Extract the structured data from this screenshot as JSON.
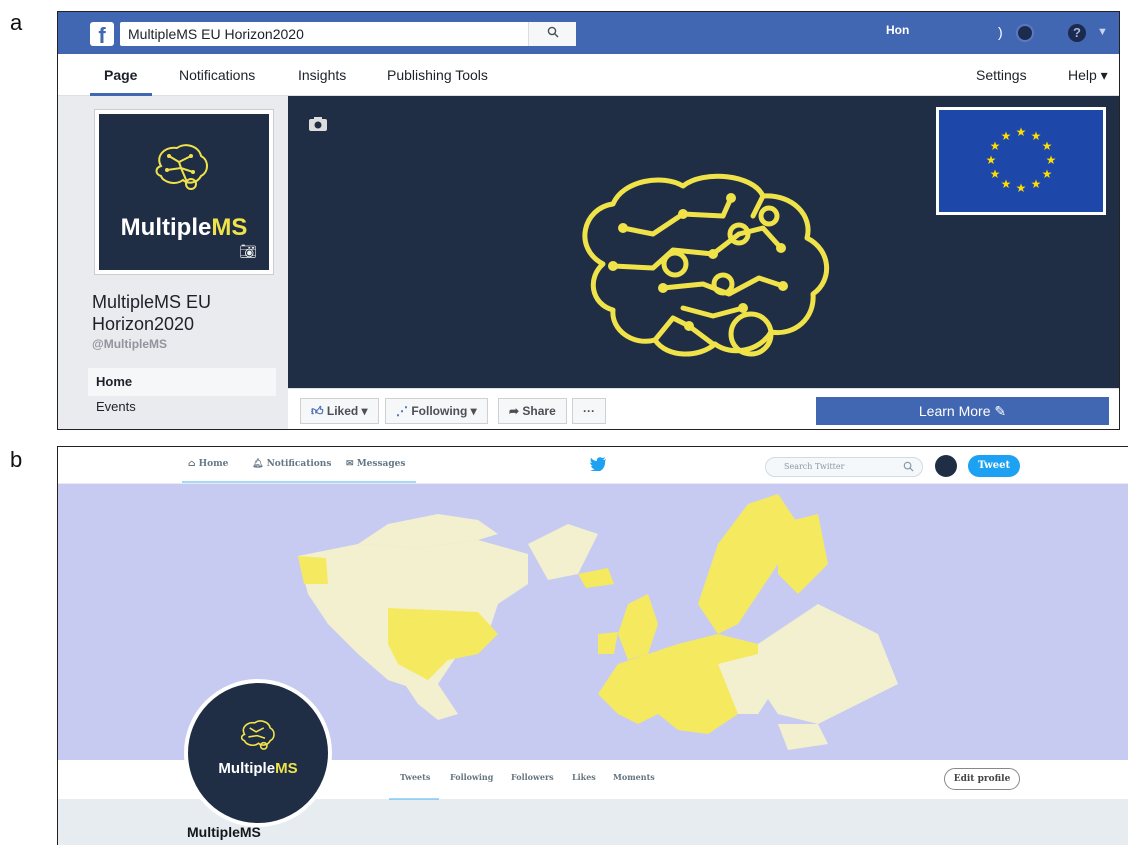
{
  "panel_letters": {
    "a": "a",
    "b": "b"
  },
  "facebook": {
    "search_value": "MultipleMS EU Horizon2020",
    "top_home": "Hon",
    "top_paren": ")",
    "tabs": [
      {
        "label": "Page"
      },
      {
        "label": "Notifications"
      },
      {
        "label": "Insights"
      },
      {
        "label": "Publishing Tools"
      },
      {
        "label": "Settings"
      },
      {
        "label": "Help ▾"
      }
    ],
    "profile_brand_left": "Multiple",
    "profile_brand_right": "MS",
    "page_name": "MultipleMS EU Horizon2020",
    "handle": "@MultipleMS",
    "nav": {
      "home": "Home",
      "events": "Events"
    },
    "actions": {
      "liked": "Liked ▾",
      "following": "Following ▾",
      "share": "Share",
      "more": "···",
      "learn_more": "Learn More"
    },
    "colors": {
      "brand_blue": "#4267b2",
      "cover_bg": "#1f2d45",
      "brain_yellow": "#f0e34a",
      "eu_blue": "#1d47a8"
    }
  },
  "twitter": {
    "nav": {
      "home": "Home",
      "notifications": "Notifications",
      "messages": "Messages"
    },
    "search_placeholder": "Search Twitter",
    "tweet_button": "Tweet",
    "profile_tabs": [
      "Tweets",
      "Following",
      "Followers",
      "Likes",
      "Moments"
    ],
    "edit_profile": "Edit profile",
    "avatar_brand_left": "Multiple",
    "avatar_brand_right": "MS",
    "display_name": "MultipleMS",
    "colors": {
      "accent": "#1da1f2",
      "banner_bg": "#c7cbf1",
      "map_highlight": "#f5e960",
      "map_land": "#f3f0cf"
    }
  }
}
